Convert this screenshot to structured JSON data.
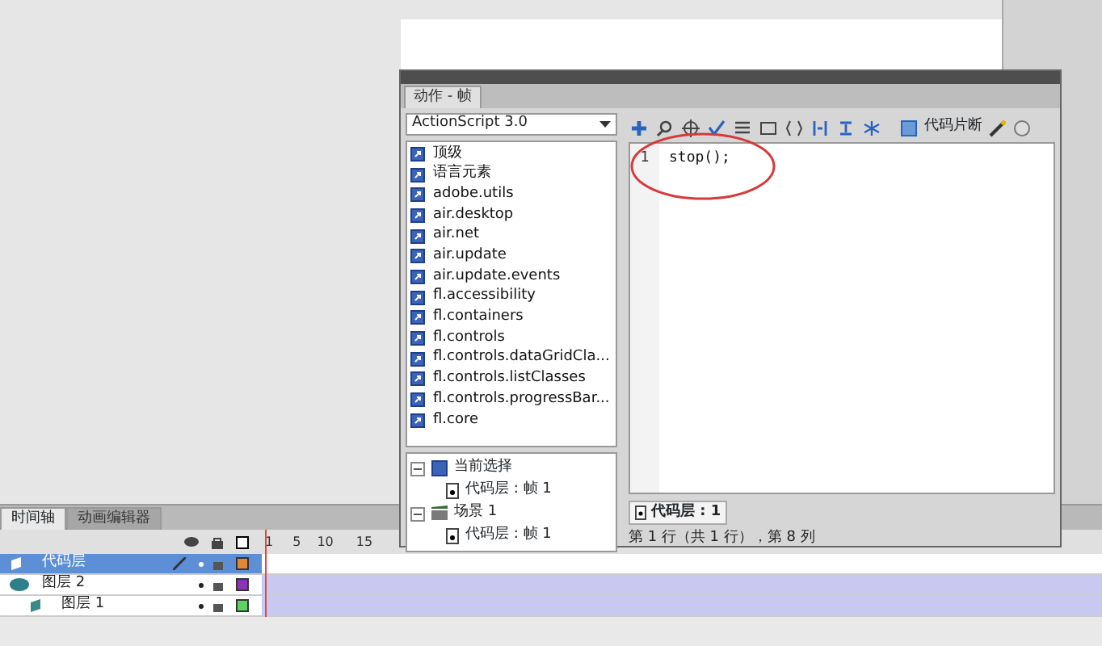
{
  "actions_panel": {
    "title": "动作 - 帧",
    "language": "ActionScript 3.0",
    "library_items": [
      "顶级",
      "语言元素",
      "adobe.utils",
      "air.desktop",
      "air.net",
      "air.update",
      "air.update.events",
      "fl.accessibility",
      "fl.containers",
      "fl.controls",
      "fl.controls.dataGridCla...",
      "fl.controls.listClasses",
      "fl.controls.progressBar...",
      "fl.core"
    ],
    "tree": [
      {
        "label": "当前选择",
        "kind": "selection",
        "expanded": true,
        "children": [
          {
            "label": "代码层 : 帧 1"
          }
        ]
      },
      {
        "label": "场景 1",
        "kind": "scene",
        "expanded": true,
        "children": [
          {
            "label": "代码层 : 帧 1"
          }
        ]
      }
    ],
    "snippets_label": "代码片断",
    "code_lines": [
      {
        "number": "1",
        "text": "stop();"
      }
    ],
    "script_tab": "代码层 : 1",
    "status": "第 1 行（共 1 行），第 8 列"
  },
  "timeline": {
    "tabs": [
      {
        "label": "时间轴",
        "selected": true
      },
      {
        "label": "动画编辑器",
        "selected": false
      }
    ],
    "frame_numbers": [
      "1",
      "5",
      "10",
      "15"
    ],
    "layers": [
      {
        "name": "代码层",
        "kind": "layer",
        "selected": true,
        "color": "#e0873a"
      },
      {
        "name": "图层 2",
        "kind": "guide",
        "selected": false,
        "color": "#8a35b5",
        "children": [
          {
            "name": "图层 1",
            "kind": "layer",
            "selected": false,
            "color": "#5fd35f"
          }
        ]
      }
    ]
  }
}
